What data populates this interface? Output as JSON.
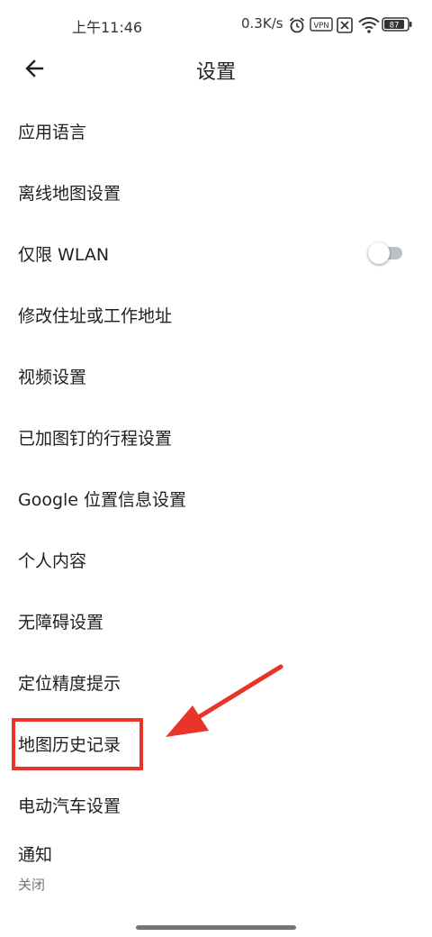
{
  "status_bar": {
    "time": "上午11:46",
    "network_speed": "0.3K/s",
    "vpn_label": "VPN",
    "battery_level": "87",
    "icons": [
      "alarm-icon",
      "vpn-icon",
      "no-sim-icon",
      "wifi-icon",
      "battery-icon"
    ]
  },
  "header": {
    "title": "设置",
    "back_icon": "arrow-back-icon"
  },
  "settings": [
    {
      "label": "应用语言"
    },
    {
      "label": "离线地图设置"
    },
    {
      "label": "仅限 WLAN",
      "toggle": false
    },
    {
      "label": "修改住址或工作地址"
    },
    {
      "label": "视频设置"
    },
    {
      "label": "已加图钉的行程设置"
    },
    {
      "label": "Google 位置信息设置"
    },
    {
      "label": "个人内容"
    },
    {
      "label": "无障碍设置"
    },
    {
      "label": "定位精度提示"
    },
    {
      "label": "地图历史记录",
      "highlighted": true
    },
    {
      "label": "电动汽车设置"
    },
    {
      "label": "通知",
      "sublabel": "关闭"
    }
  ],
  "colors": {
    "highlight": "#e8352a",
    "text": "#202124",
    "secondary_text": "#70757a"
  }
}
